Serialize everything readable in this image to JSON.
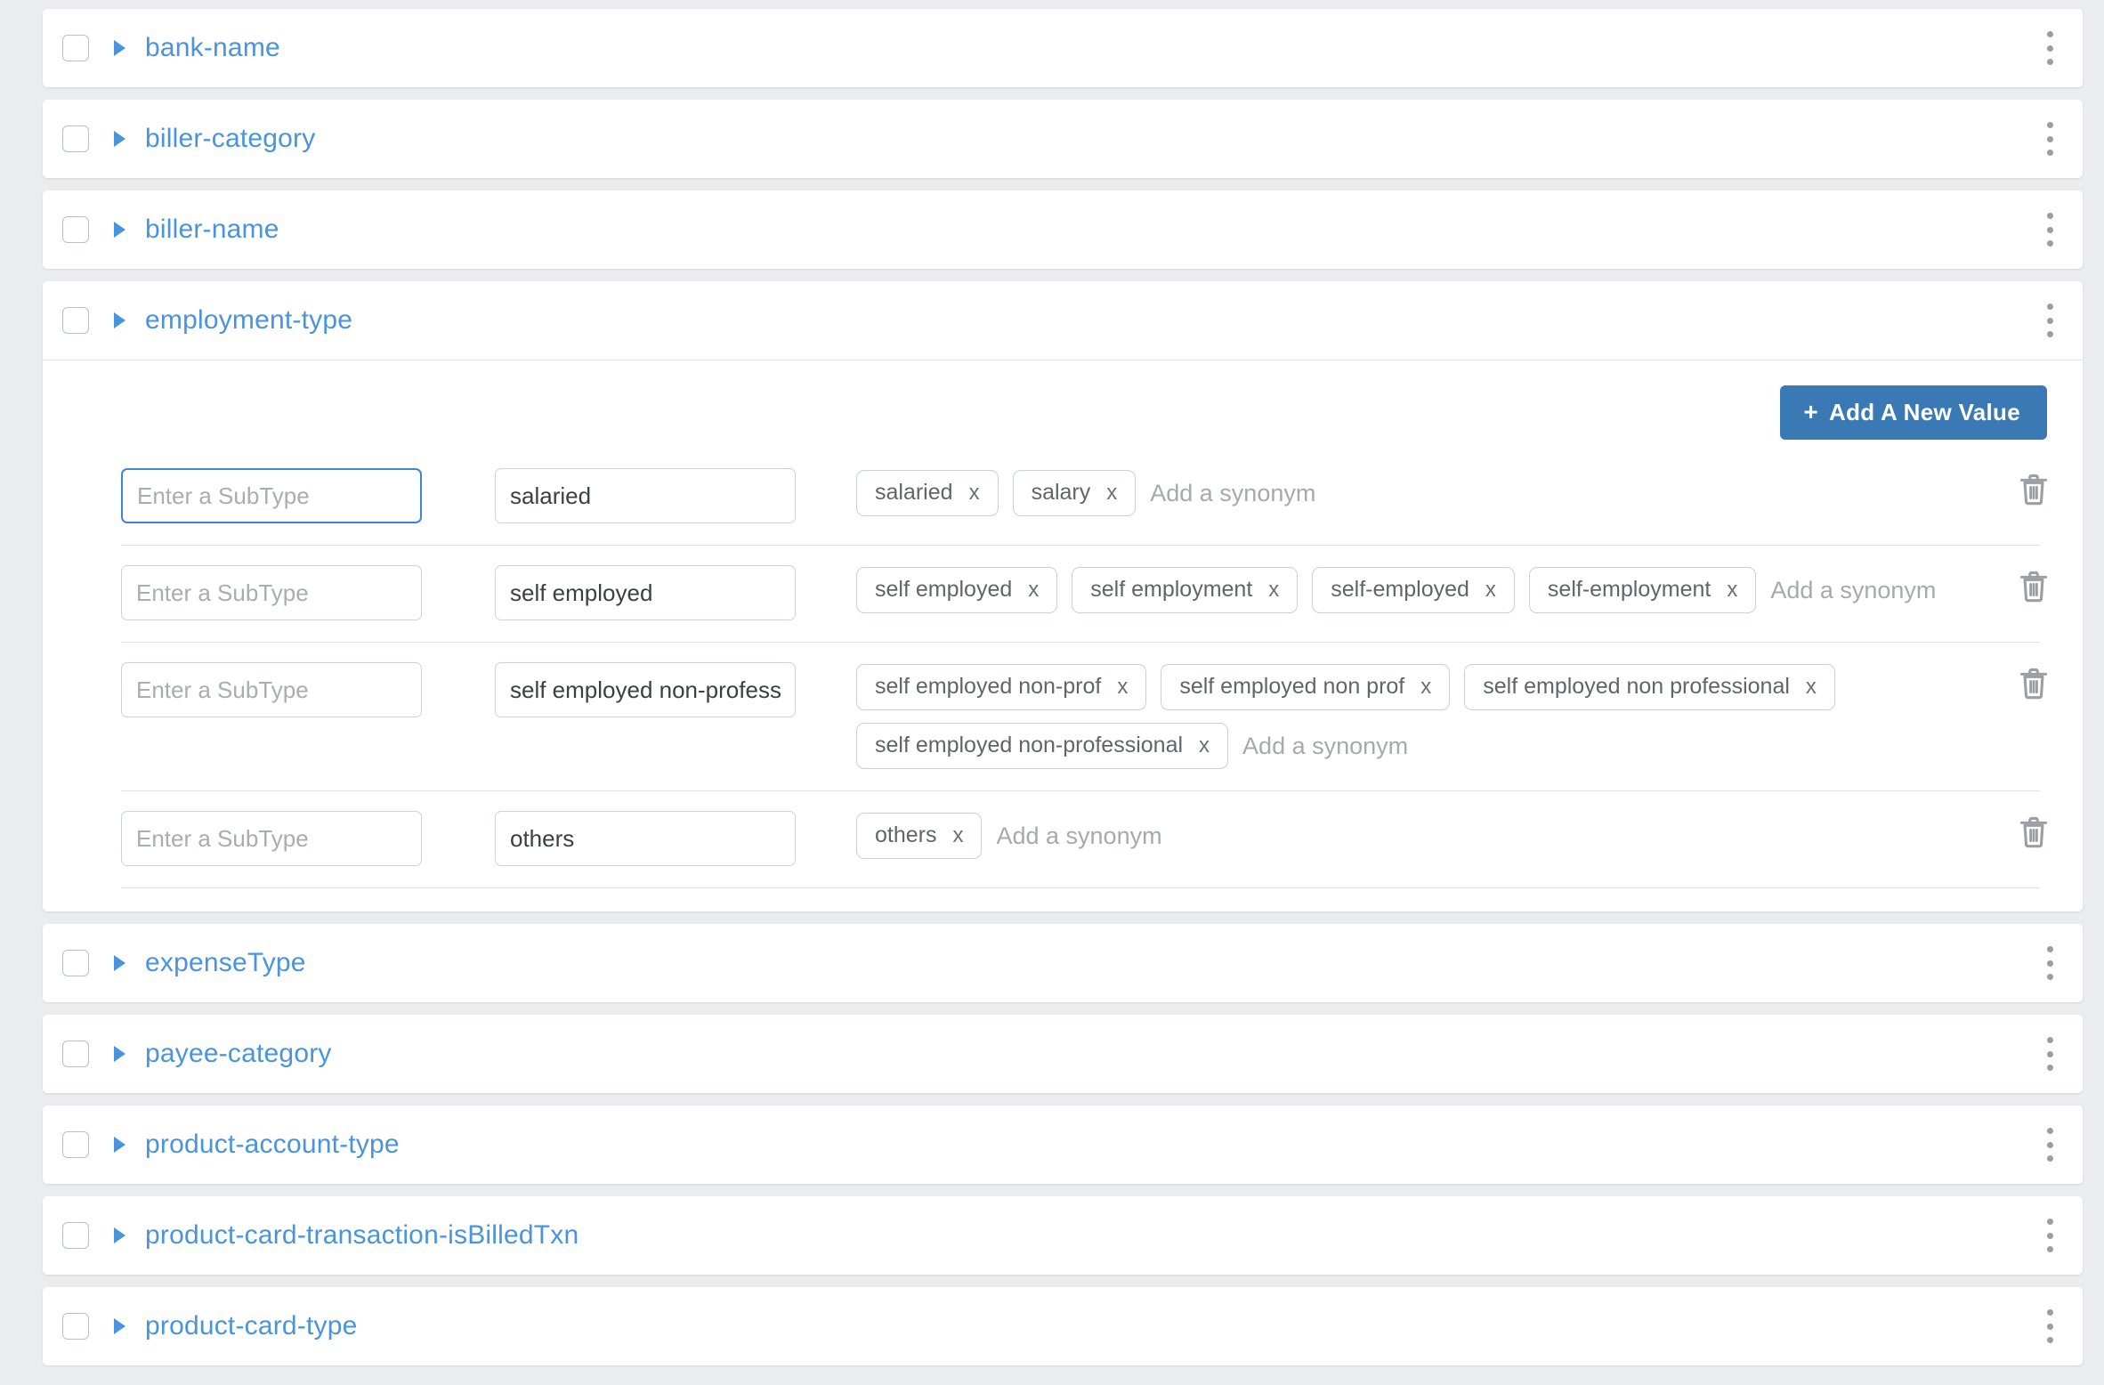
{
  "colors": {
    "page_background": "#eaecef",
    "card_background": "#ffffff",
    "entity_link": "#4a93dd",
    "primary_button": "#3a79b3",
    "focus_border": "#3f83e0",
    "muted_text": "#a5aaaf"
  },
  "entities_before": [
    {
      "name": "bank-name"
    },
    {
      "name": "biller-category"
    },
    {
      "name": "biller-name"
    }
  ],
  "expanded_entity": {
    "name": "employment-type",
    "add_value_button": {
      "label": "Add A New Value",
      "icon": "plus-icon",
      "plus": "+"
    },
    "subtype_placeholder": "Enter a SubType",
    "add_synonym_placeholder": "Add a synonym",
    "remove_chip_label": "x",
    "rows": [
      {
        "subtype": "",
        "subtype_focused": true,
        "value": "salaried",
        "synonyms": [
          "salaried",
          "salary"
        ]
      },
      {
        "subtype": "",
        "subtype_focused": false,
        "value": "self employed",
        "synonyms": [
          "self employed",
          "self employment",
          "self-employed",
          "self-employment"
        ]
      },
      {
        "subtype": "",
        "subtype_focused": false,
        "value": "self employed non-professional",
        "synonyms": [
          "self employed non-prof",
          "self employed non prof",
          "self employed non professional",
          "self employed non-professional"
        ]
      },
      {
        "subtype": "",
        "subtype_focused": false,
        "value": "others",
        "synonyms": [
          "others"
        ]
      }
    ]
  },
  "entities_after": [
    {
      "name": "expenseType"
    },
    {
      "name": "payee-category"
    },
    {
      "name": "product-account-type"
    },
    {
      "name": "product-card-transaction-isBilledTxn"
    },
    {
      "name": "product-card-type"
    }
  ]
}
